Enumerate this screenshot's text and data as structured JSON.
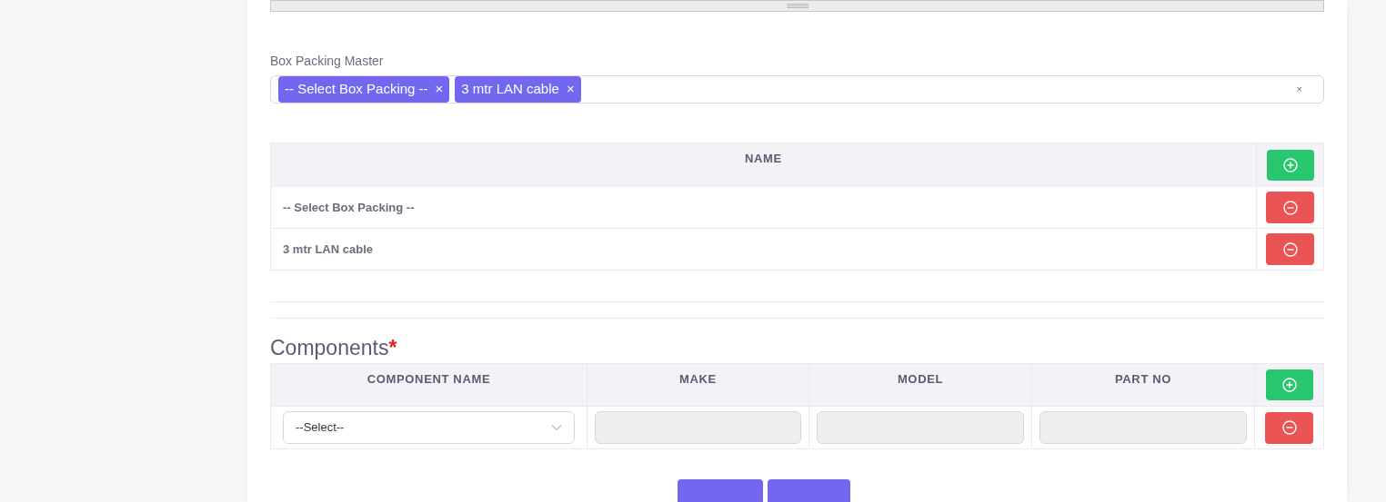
{
  "box_packing": {
    "label": "Box Packing Master",
    "tags": [
      {
        "label": "-- Select Box Packing --",
        "remove": "×"
      },
      {
        "label": "3 mtr LAN cable",
        "remove": "×"
      }
    ],
    "clear": "×"
  },
  "packing_table": {
    "columns": [
      "NAME"
    ],
    "rows": [
      "-- Select Box Packing --",
      "3 mtr LAN cable"
    ]
  },
  "components": {
    "title": "Components",
    "required": "*",
    "columns": [
      "COMPONENT NAME",
      "MAKE",
      "MODEL",
      "PART NO"
    ],
    "rows": [
      {
        "component": "--Select--"
      }
    ]
  },
  "footer_buttons": [
    {
      "kind": "primary"
    },
    {
      "kind": "primary"
    }
  ]
}
